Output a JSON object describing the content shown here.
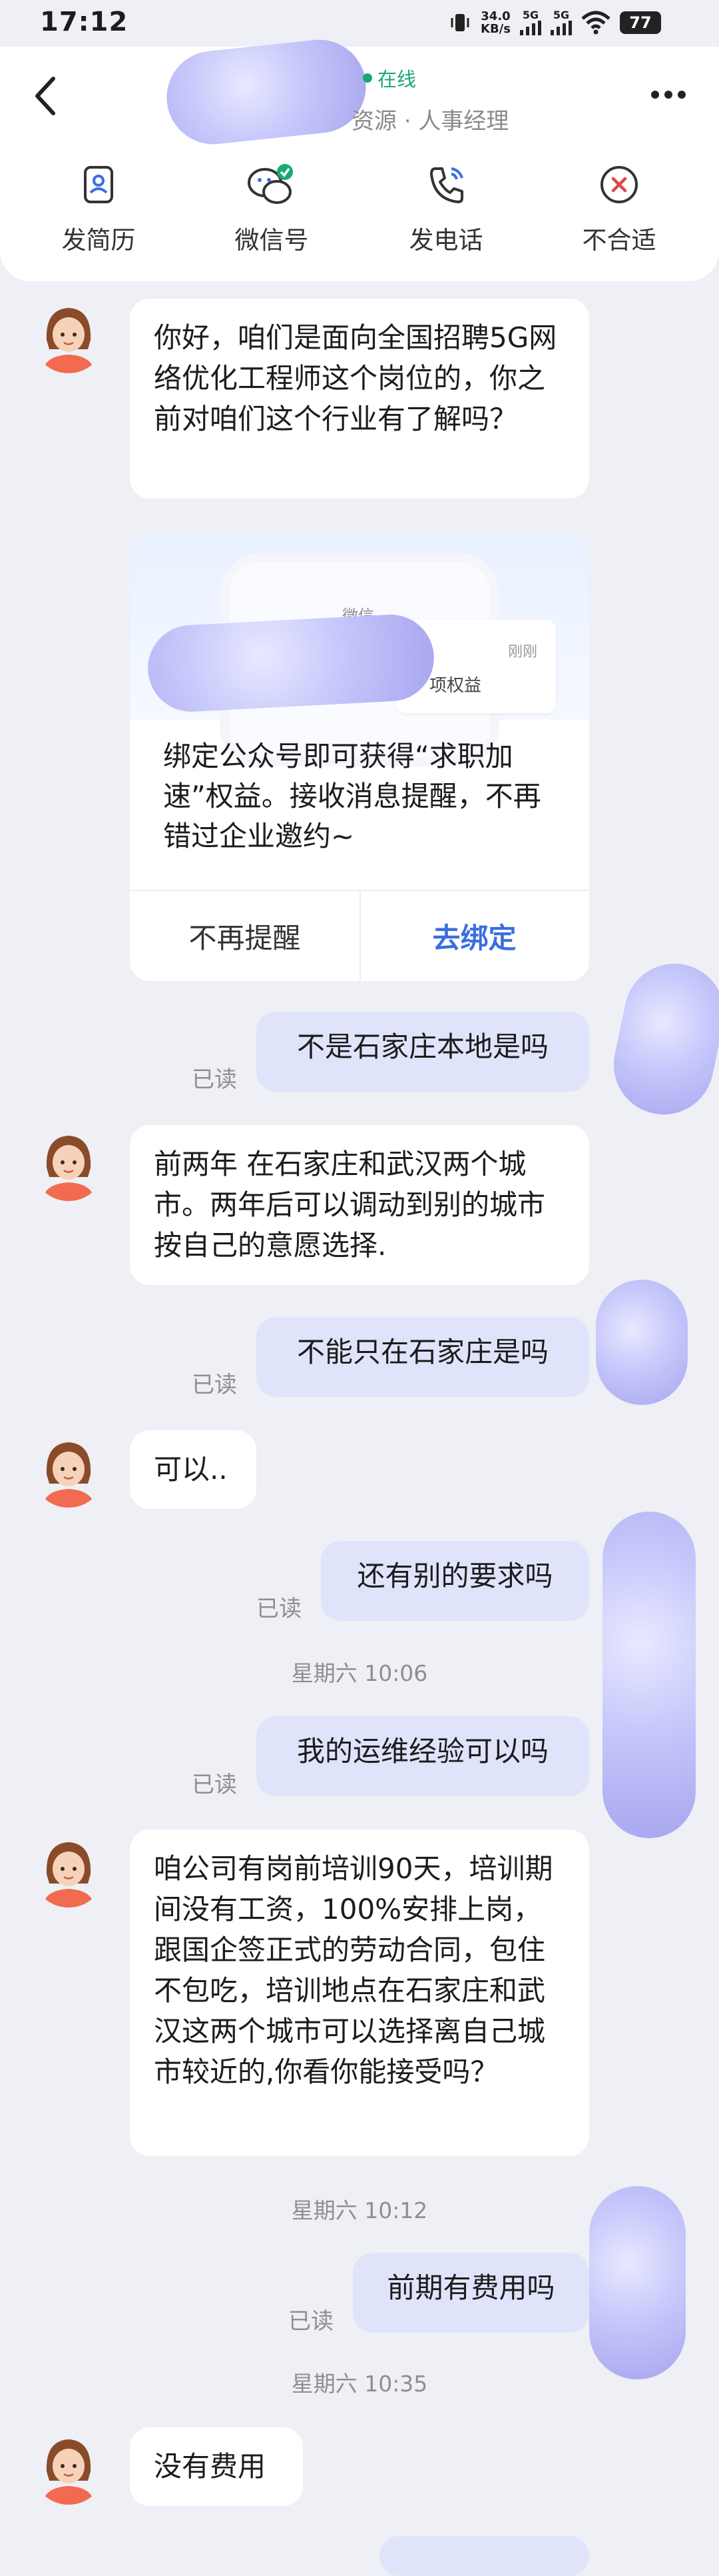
{
  "status_bar": {
    "time": "17:12",
    "net_speed": "34.0",
    "net_unit": "KB/s",
    "signal1": "5G",
    "signal2": "5G",
    "battery": "77"
  },
  "header": {
    "online": "在线",
    "subtitle": "资源 · 人事经理"
  },
  "actions": [
    {
      "label": "发简历",
      "icon": "resume-icon"
    },
    {
      "label": "微信号",
      "icon": "wechat-icon"
    },
    {
      "label": "发电话",
      "icon": "phone-icon"
    },
    {
      "label": "不合适",
      "icon": "reject-icon"
    }
  ],
  "promo": {
    "brand": "微信",
    "mini_time": "刚刚",
    "mini_text": "项权益",
    "text": "绑定公众号即可获得“求职加速”权益。接收消息提醒，不再错过企业邀约~",
    "dismiss_label": "不再提醒",
    "bind_label": "去绑定"
  },
  "messages": {
    "m1": "你好，咱们是面向全国招聘5G网络优化工程师这个岗位的，你之前对咱们这个行业有了解吗？",
    "m2": "不是石家庄本地是吗",
    "m3": "前两年 在石家庄和武汉两个城市。两年后可以调动到别的城市 按自己的意愿选择.",
    "m4": "不能只在石家庄是吗",
    "m5": "可以..",
    "m6": "还有别的要求吗",
    "t1": "星期六 10:06",
    "m7": "我的运维经验可以吗",
    "m8": "咱公司有岗前培训90天，培训期间没有工资，100%安排上岗，跟国企签正式的劳动合同，包住不包吃，培训地点在石家庄和武汉这两个城市可以选择离自己城市较近的,你看你能接受吗？",
    "t2": "星期六 10:12",
    "m9": "前期有费用吗",
    "t3": "星期六 10:35",
    "m10": "没有费用"
  },
  "read_label": "已读",
  "colors": {
    "accent": "#3b6fe0",
    "online": "#1aa971",
    "out_bubble": "#dfe4fa",
    "reject": "#e0454c"
  }
}
